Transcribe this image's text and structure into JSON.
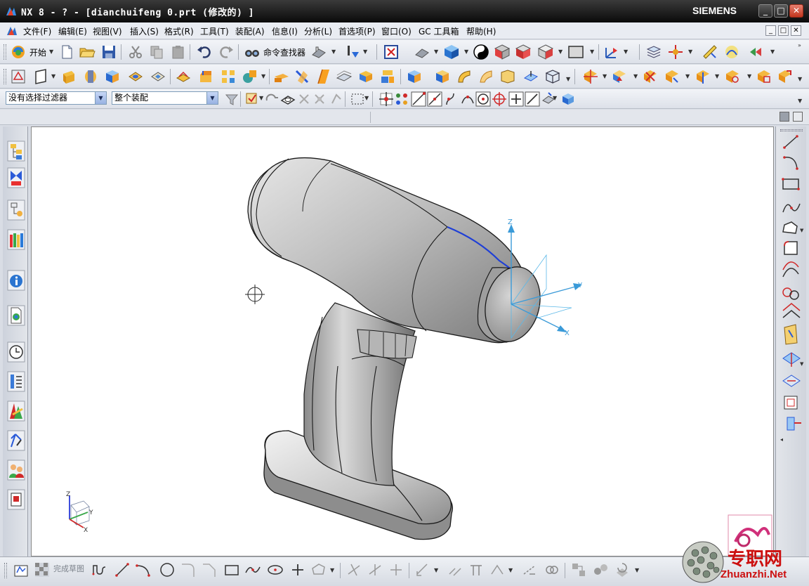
{
  "window": {
    "title": "NX 8 - ? - [dianchuifeng 0.prt  (修改的) ]",
    "brand": "SIEMENS",
    "controls": [
      "_",
      "□",
      "✕"
    ]
  },
  "menubar": {
    "items": [
      "文件(F)",
      "编辑(E)",
      "视图(V)",
      "插入(S)",
      "格式(R)",
      "工具(T)",
      "装配(A)",
      "信息(I)",
      "分析(L)",
      "首选项(P)",
      "窗口(O)",
      "GC 工具箱",
      "帮助(H)"
    ],
    "doc_controls": [
      "_",
      "□",
      "✕"
    ]
  },
  "standard_toolbar": {
    "start_label": "开始",
    "command_finder_label": "命令查找器"
  },
  "selection_bar": {
    "filter_value": "没有选择过滤器",
    "scope_value": "整个装配"
  },
  "sketch_toolbar": {
    "finish_sketch_label": "完成草图"
  },
  "viewport": {
    "wcs_labels": {
      "x": "X",
      "y": "Y",
      "z": "Z"
    },
    "triad_labels": {
      "x": "X",
      "y": "Y",
      "z": "Z"
    }
  },
  "watermark": {
    "brand_cn": "专职网",
    "brand_url": "Zhuanzhi.Net"
  },
  "colors": {
    "title_bar": "#1a1a1a",
    "close_button": "#c8402a",
    "graphics_background": "#ffffff",
    "selected_edge": "#1f3fd6",
    "model_shade": "#a9a9a9",
    "watermark_red": "#cc1010"
  },
  "icons": {
    "resource_bar": [
      "assembly-navigator-icon",
      "constraint-navigator-icon",
      "part-navigator-icon",
      "reuse-library-icon",
      "hd3d-tools-icon",
      "web-browser-icon",
      "history-icon",
      "process-studio-icon",
      "manufacturing-wizards-icon",
      "roles-icon",
      "system-scenes-icon",
      "palettes-icon"
    ],
    "sketch_bar": [
      "profile-icon",
      "line-icon",
      "arc-icon",
      "circle-icon",
      "fillet-icon",
      "chamfer-icon",
      "rectangle-icon",
      "studio-spline-icon",
      "ellipse-icon",
      "point-icon",
      "polygon-icon"
    ]
  }
}
